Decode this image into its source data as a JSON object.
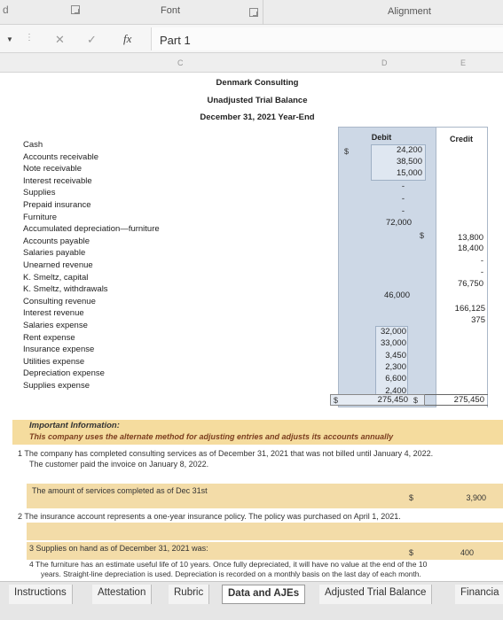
{
  "ribbon": {
    "left_edge": "d",
    "font_label": "Font",
    "alignment_label": "Alignment"
  },
  "formula_bar": {
    "cancel_icon": "✕",
    "enter_icon": "✓",
    "fx_icon": "fx",
    "value": "Part 1"
  },
  "columns": {
    "c": "C",
    "d": "D",
    "e": "E"
  },
  "header": {
    "company": "Denmark Consulting",
    "title": "Unadjusted Trial Balance",
    "date": "December 31, 2021 Year-End"
  },
  "col_heads": {
    "debit": "Debit",
    "credit": "Credit"
  },
  "accounts": [
    "Cash",
    "Accounts receivable",
    "Note receivable",
    "Interest receivable",
    "Supplies",
    "Prepaid insurance",
    "Furniture",
    "Accumulated depreciation—furniture",
    "Accounts payable",
    "Salaries payable",
    "Unearned revenue",
    "K. Smeltz, capital",
    "K. Smeltz, withdrawals",
    "Consulting revenue",
    "Interest revenue",
    "Salaries expense",
    "Rent expense",
    "Insurance expense",
    "Utilities expense",
    "Depreciation expense",
    "Supplies expense"
  ],
  "debits": {
    "cash_symbol": "$",
    "cash": "24,200",
    "ar": "38,500",
    "nr": "15,000",
    "ir": "-",
    "supplies": "-",
    "prepaid": "-",
    "furniture": "72,000",
    "withdrawals": "46,000",
    "salaries_exp": "32,000",
    "rent_exp": "33,000",
    "ins_exp": "3,450",
    "util_exp": "2,300",
    "dep_exp": "6,600",
    "supplies_exp": "2,400",
    "total_symbol": "$",
    "total": "275,450"
  },
  "credits": {
    "accum_symbol": "$",
    "accum": "13,800",
    "ap": "18,400",
    "sal_pay": "-",
    "unearned": "-",
    "capital": "76,750",
    "consulting": "166,125",
    "interest": "375",
    "total_symbol": "$",
    "total": "275,450"
  },
  "info": {
    "title": "Important Information:",
    "subtitle": "This company uses the alternate method for adjusting entries and adjusts its accounts annually"
  },
  "questions": {
    "q1_line1": "1  The company has completed consulting services as of December 31, 2021 that was not billed until January 4, 2022.",
    "q1_line2": "The customer paid the invoice on January 8, 2022.",
    "q1_prompt": "The amount of services completed as of Dec 31st",
    "q1_symbol": "$",
    "q1_value": "3,900",
    "q2_line1": "2  The insurance account represents a one-year insurance policy. The policy was purchased on April 1, 2021.",
    "q3_prompt": "3  Supplies on hand as of December 31, 2021 was:",
    "q3_symbol": "$",
    "q3_value": "400",
    "q4_line1": "4  The furniture has an estimate useful life of 10 years. Once fully depreciated, it will have no value at the end of the 10",
    "q4_line2": "years. Straight-line depreciation is used. Depreciation is recorded on a monthly basis on the last day of each month."
  },
  "tabs": [
    "Instructions",
    "Attestation",
    "Rubric",
    "Data and AJEs",
    "Adjusted Trial Balance",
    "Financia"
  ]
}
